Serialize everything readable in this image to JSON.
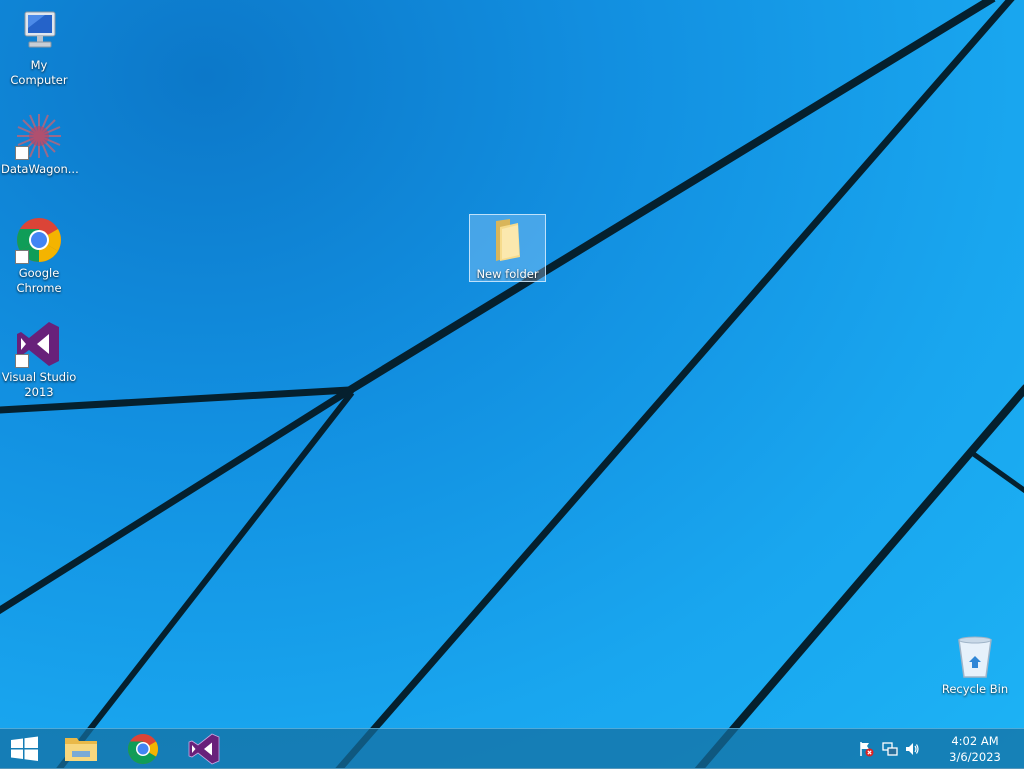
{
  "desktop": {
    "icons": [
      {
        "label": "My Computer"
      },
      {
        "label": "DataWagon..."
      },
      {
        "label": "Google Chrome"
      },
      {
        "label": "Visual Studio 2013"
      },
      {
        "label": "New folder"
      },
      {
        "label": "Recycle Bin"
      }
    ]
  },
  "taskbar": {
    "clock": {
      "time": "4:02 AM",
      "date": "3/6/2023"
    }
  },
  "colors": {
    "desktop_blue": "#1a9fe9",
    "taskbar": "#146ea0",
    "line": "#062a3a"
  }
}
